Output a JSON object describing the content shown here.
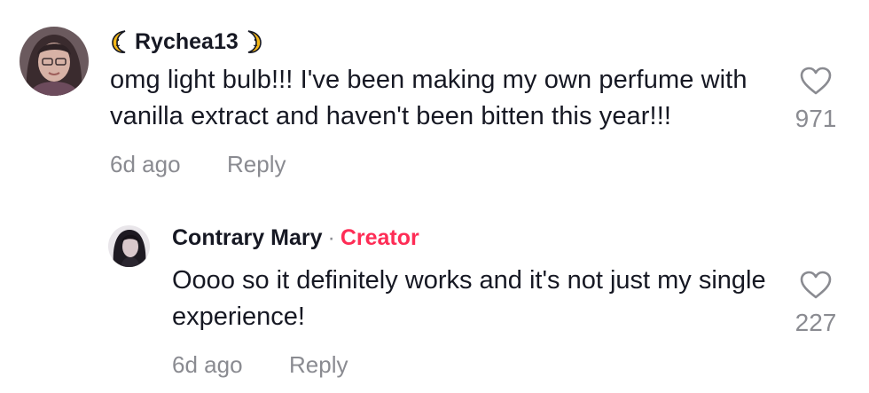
{
  "main_comment": {
    "username": "Rychea13",
    "username_decoration": "crescent-moon-icon",
    "text": "omg light bulb!!! I've been making my own perfume with vanilla extract and haven't been bitten this year!!!",
    "time": "6d ago",
    "reply_label": "Reply",
    "like_count": "971",
    "avatar": "profile-photo-avatar"
  },
  "reply_comment": {
    "username": "Contrary Mary",
    "separator": "·",
    "badge": "Creator",
    "text": "Oooo so it definitely works and it's not just my single experience!",
    "time": "6d ago",
    "reply_label": "Reply",
    "like_count": "227",
    "avatar": "profile-photo-avatar"
  },
  "colors": {
    "text": "#161823",
    "muted": "#8a8b91",
    "creator": "#fe2c55",
    "moon": "#f5b818"
  }
}
